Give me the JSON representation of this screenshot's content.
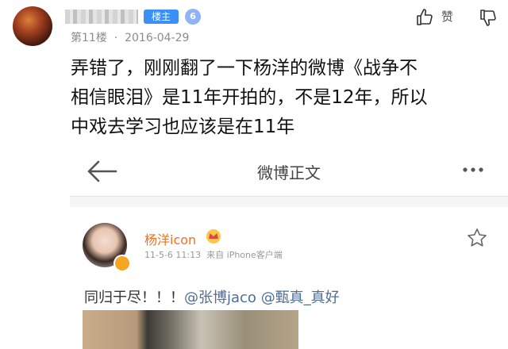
{
  "reply": {
    "owner_badge": "楼主",
    "level": "6",
    "floor": "第11楼",
    "separator": "·",
    "date": "2016-04-29",
    "like_label": "赞",
    "dislike_label": "踩",
    "body_lines": [
      "弄错了，刚刚翻了一下杨洋的微博《战争不",
      "相信眼泪》是11年开拍的，不是12年，所以",
      "中戏去学习也应该是在11年"
    ]
  },
  "embed": {
    "title": "微博正文",
    "user_name": "杨洋icon",
    "meta_time": "11-5-6 11:13",
    "meta_source": "来自 iPhone客户端",
    "text_prefix": "同归于尽！！！",
    "mention_1": "@张博jaco",
    "mention_2": "@甄真_真好"
  },
  "colors": {
    "badge_blue": "#3b8ff5",
    "mention": "#4d6d95",
    "weibo_name": "#f2711c"
  },
  "icons": [
    "back-arrow-icon",
    "more-dots-icon",
    "thumbs-up-icon",
    "thumbs-down-icon",
    "crown-icon",
    "star-icon",
    "verified-icon"
  ]
}
